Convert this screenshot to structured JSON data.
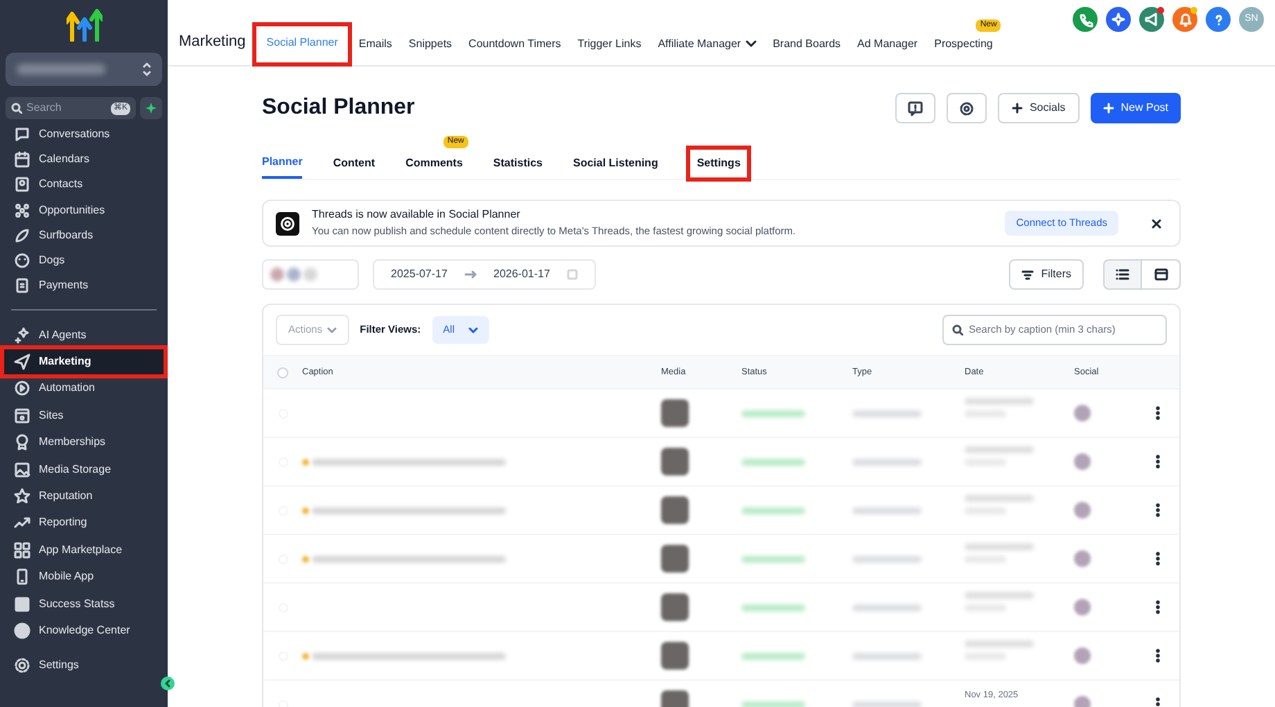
{
  "sidebar": {
    "search": {
      "placeholder": "Search",
      "shortcut": "⌘K"
    },
    "items": [
      {
        "label": "Conversations",
        "selected": false
      },
      {
        "label": "Calendars",
        "selected": false
      },
      {
        "label": "Contacts",
        "selected": false
      },
      {
        "label": "Opportunities",
        "selected": false
      },
      {
        "label": "Surfboards",
        "selected": false
      },
      {
        "label": "Dogs",
        "selected": false
      },
      {
        "label": "Payments",
        "selected": false
      }
    ],
    "items_2": [
      {
        "label": "AI Agents",
        "selected": false,
        "highlighted": false
      },
      {
        "label": "Marketing",
        "selected": true,
        "highlighted": true
      },
      {
        "label": "Automation",
        "selected": false,
        "highlighted": false
      },
      {
        "label": "Sites",
        "selected": false,
        "highlighted": false
      },
      {
        "label": "Memberships",
        "selected": false,
        "highlighted": false
      },
      {
        "label": "Media Storage",
        "selected": false,
        "highlighted": false
      },
      {
        "label": "Reputation",
        "selected": false,
        "highlighted": false
      },
      {
        "label": "Reporting",
        "selected": false,
        "highlighted": false
      },
      {
        "label": "App Marketplace",
        "selected": false,
        "highlighted": false
      },
      {
        "label": "Mobile App",
        "selected": false,
        "highlighted": false
      },
      {
        "label": "Success Statss",
        "selected": false,
        "highlighted": false
      },
      {
        "label": "Knowledge Center",
        "selected": false,
        "highlighted": false
      }
    ],
    "settings": "Settings"
  },
  "top_nav": {
    "title": "Marketing",
    "tabs": [
      {
        "label": "Social Planner",
        "selected": true,
        "highlighted": true
      },
      {
        "label": "Emails",
        "selected": false,
        "highlighted": false
      },
      {
        "label": "Snippets",
        "selected": false,
        "highlighted": false
      },
      {
        "label": "Countdown Timers",
        "selected": false,
        "highlighted": false
      },
      {
        "label": "Trigger Links",
        "selected": false,
        "highlighted": false
      },
      {
        "label": "Affiliate Manager",
        "selected": false,
        "highlighted": false,
        "dropdown": true
      },
      {
        "label": "Brand Boards",
        "selected": false,
        "highlighted": false
      },
      {
        "label": "Ad Manager",
        "selected": false,
        "highlighted": false
      },
      {
        "label": "Prospecting",
        "selected": false,
        "highlighted": false,
        "badge": "New"
      }
    ],
    "avatar": "SN"
  },
  "page": {
    "title": "Social Planner",
    "socials_button": "Socials",
    "new_post_button": "New Post",
    "tabs": [
      {
        "label": "Planner",
        "selected": true,
        "highlighted": false
      },
      {
        "label": "Content",
        "selected": false,
        "highlighted": false
      },
      {
        "label": "Comments",
        "selected": false,
        "highlighted": false,
        "badge": "New"
      },
      {
        "label": "Statistics",
        "selected": false,
        "highlighted": false
      },
      {
        "label": "Social Listening",
        "selected": false,
        "highlighted": false
      },
      {
        "label": "Settings",
        "selected": false,
        "highlighted": true
      }
    ],
    "banner": {
      "title": "Threads is now available in Social Planner",
      "text": "You can now publish and schedule content directly to Meta's Threads, the fastest growing social platform.",
      "button": "Connect to Threads"
    },
    "date_range": {
      "start": "2025-07-17",
      "end": "2026-01-17"
    },
    "filters_button": "Filters",
    "view_toggles": [
      {
        "selected": true
      },
      {
        "selected": false
      }
    ],
    "table": {
      "actions": "Actions",
      "filter_views_label": "Filter Views:",
      "filter_view": "All",
      "search_placeholder": "Search by caption (min 3 chars)",
      "select_all_checked": false,
      "columns": [
        "Caption",
        "Media",
        "Status",
        "Type",
        "Date",
        "Social"
      ],
      "rows": [
        {
          "checked": false,
          "has_caption": false
        },
        {
          "checked": false,
          "has_caption": true
        },
        {
          "checked": false,
          "has_caption": true
        },
        {
          "checked": false,
          "has_caption": true
        },
        {
          "checked": false,
          "has_caption": false
        },
        {
          "checked": false,
          "has_caption": true
        },
        {
          "checked": false,
          "has_caption": false,
          "date": "Nov 19, 2025"
        }
      ]
    }
  }
}
